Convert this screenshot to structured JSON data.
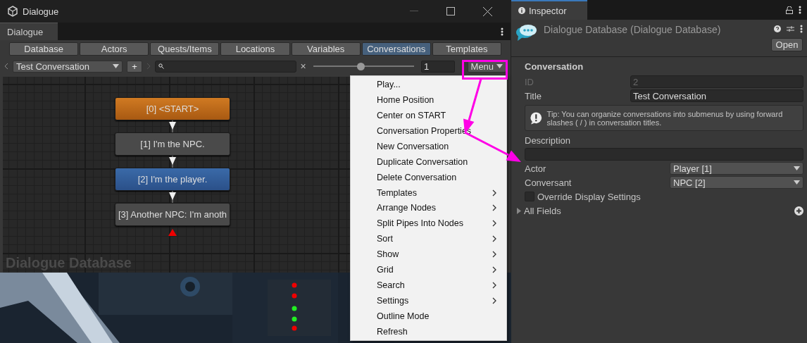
{
  "window": {
    "title": "Dialogue",
    "tab": "Dialogue"
  },
  "tabs": [
    {
      "label": "Database",
      "selected": false
    },
    {
      "label": "Actors",
      "selected": false
    },
    {
      "label": "Quests/Items",
      "selected": false
    },
    {
      "label": "Locations",
      "selected": false
    },
    {
      "label": "Variables",
      "selected": false
    },
    {
      "label": "Conversations",
      "selected": true
    },
    {
      "label": "Templates",
      "selected": false
    }
  ],
  "toolbar": {
    "conversation": "Test Conversation",
    "add_button": "+",
    "clear_button": "×",
    "zoom": {
      "level": 0.47
    },
    "zoom_value": "1",
    "menu_button": "Menu"
  },
  "canvas": {
    "nodes": [
      {
        "label": "[0] <START>",
        "kind": "start"
      },
      {
        "label": "[1] I'm the NPC.",
        "kind": "npc"
      },
      {
        "label": "[2] I'm the player.",
        "kind": "player"
      },
      {
        "label": "[3] Another NPC: I'm anoth",
        "kind": "npc"
      }
    ],
    "watermark": "Dialogue Database"
  },
  "menu": {
    "items": [
      {
        "label": "Play...",
        "submenu": false
      },
      {
        "label": "Home Position",
        "submenu": false
      },
      {
        "label": "Center on START",
        "submenu": false
      },
      {
        "label": "Conversation Properties",
        "submenu": false
      },
      {
        "label": "New Conversation",
        "submenu": false
      },
      {
        "label": "Duplicate Conversation",
        "submenu": false
      },
      {
        "label": "Delete Conversation",
        "submenu": false
      },
      {
        "label": "Templates",
        "submenu": true
      },
      {
        "label": "Arrange Nodes",
        "submenu": true
      },
      {
        "label": "Split Pipes Into Nodes",
        "submenu": true
      },
      {
        "label": "Sort",
        "submenu": true
      },
      {
        "label": "Show",
        "submenu": true
      },
      {
        "label": "Grid",
        "submenu": true
      },
      {
        "label": "Search",
        "submenu": true
      },
      {
        "label": "Settings",
        "submenu": true
      },
      {
        "label": "Outline Mode",
        "submenu": false
      },
      {
        "label": "Refresh",
        "submenu": false
      }
    ]
  },
  "inspector": {
    "tab": "Inspector",
    "object_title": "Dialogue Database (Dialogue Database)",
    "open_button": "Open",
    "section": "Conversation",
    "fields": [
      {
        "label": "ID",
        "value": "2",
        "disabled": true
      },
      {
        "label": "Title",
        "value": "Test Conversation",
        "disabled": false
      }
    ],
    "tip": "Tip: You can organize conversations into submenus by using forward slashes ( / ) in conversation titles.",
    "description": {
      "label": "Description"
    },
    "dropdowns": [
      {
        "label": "Actor",
        "value": "Player [1]"
      },
      {
        "label": "Conversant",
        "value": "NPC [2]"
      }
    ],
    "override": {
      "label": "Override Display Settings",
      "checked": false
    },
    "all_fields": {
      "label": "All Fields",
      "expanded": false
    }
  }
}
